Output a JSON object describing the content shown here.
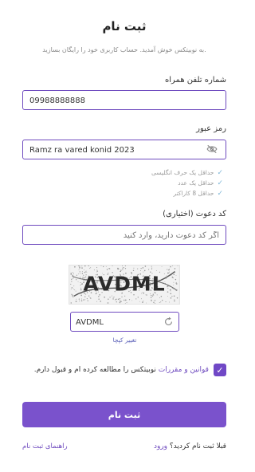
{
  "header": {
    "title": "ثبت نام",
    "subtitle": "به نوبیتکس خوش آمدید. حساب کاربری خود را رایگان بسازید."
  },
  "phone": {
    "label": "شماره تلفن همراه",
    "value": "09988888888"
  },
  "password": {
    "label": "رمز عبور",
    "value": "Ramz ra vared konid 2023",
    "visibility_icon": "eye-off-icon"
  },
  "password_rules": [
    "حداقل یک حرف انگلیسی",
    "حداقل یک عدد",
    "حداقل 8 کاراکتر"
  ],
  "invite_code": {
    "label": "کد دعوت (اختیاری)",
    "placeholder": "اگر کد دعوت دارید، وارد کنید"
  },
  "captcha": {
    "image_text": "AVDML",
    "value": "AVDML",
    "change_label": "تغییر کپچا",
    "refresh_icon": "refresh-icon"
  },
  "terms": {
    "checked": true,
    "link_text": "قوانین و مقررات",
    "rest_text": " نوبیتکس را مطالعه کرده ام و قبول دارم."
  },
  "submit_label": "ثبت نام",
  "footer": {
    "already_text": "قبلا ثبت نام کردید؟ ",
    "login_link": "ورود",
    "guide_link": "راهنمای ثبت نام"
  },
  "colors": {
    "accent": "#7a52cc",
    "border": "#6f4bbf",
    "check": "#7fb7d8"
  }
}
